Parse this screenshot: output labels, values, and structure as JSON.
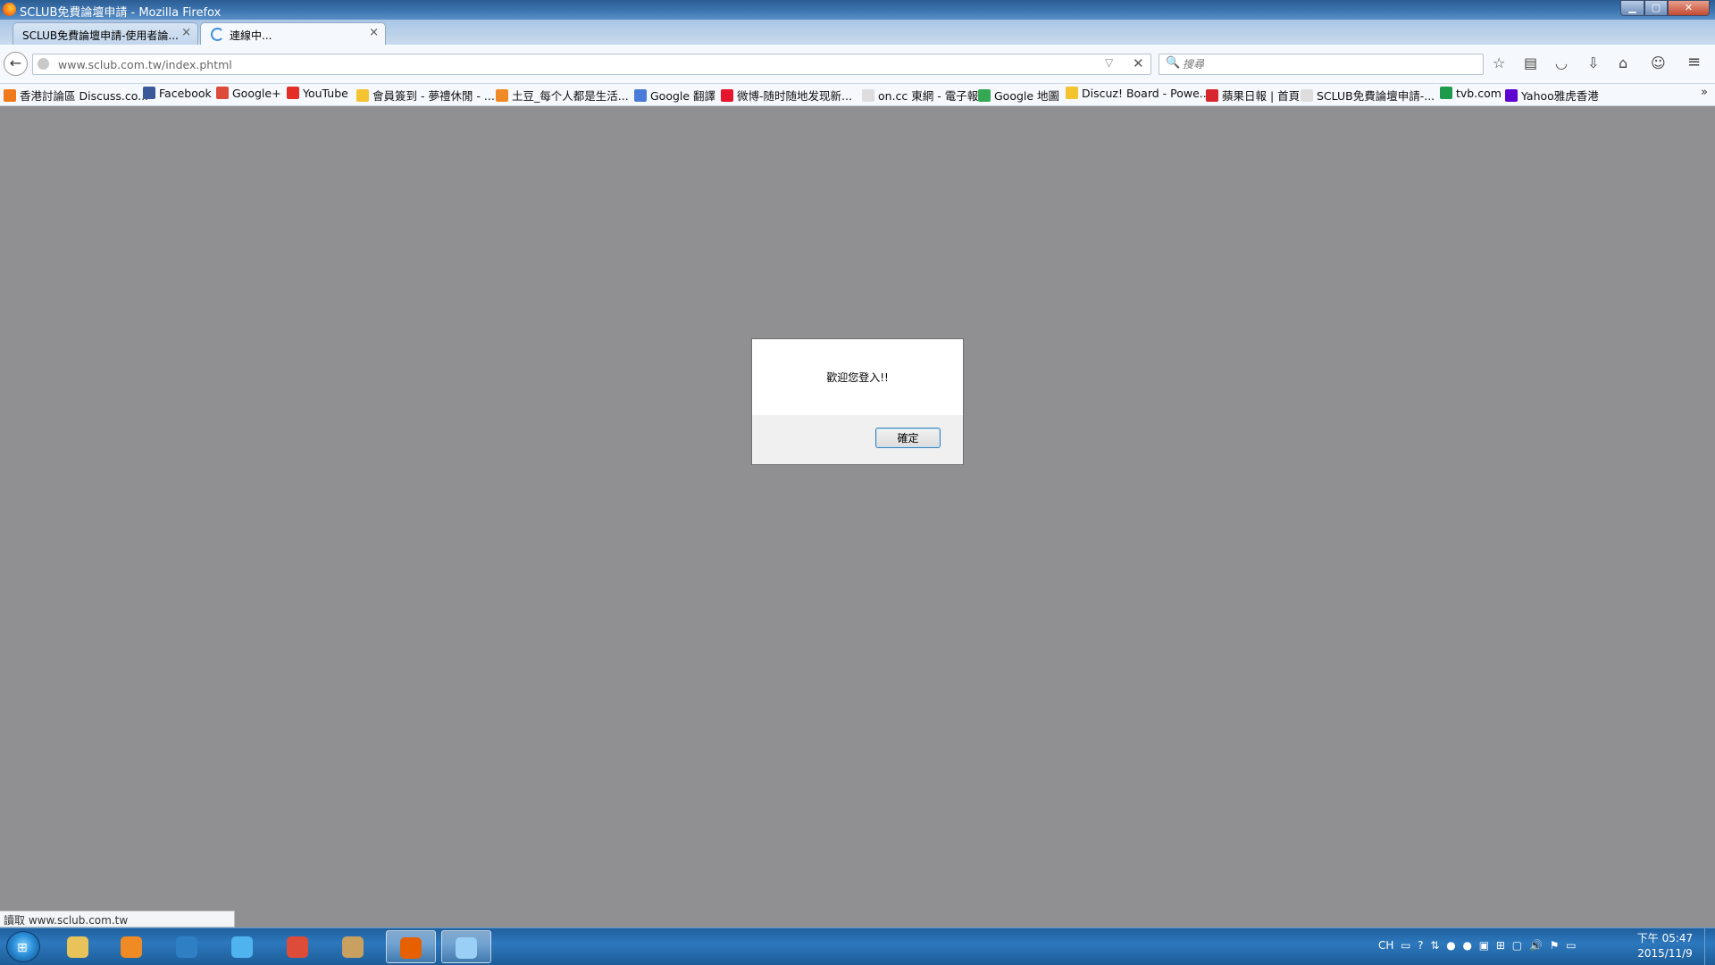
{
  "window": {
    "title": "SCLUB免費論壇申請 - Mozilla Firefox",
    "min_glyph": "▁",
    "max_glyph": "▢",
    "close_glyph": "✕"
  },
  "tabs": [
    {
      "label": "SCLUB免費論壇申請-使用者論...",
      "close": "×",
      "active": false
    },
    {
      "label": "連線中...",
      "close": "×",
      "active": true,
      "loading": true
    }
  ],
  "new_tab_glyph": "+",
  "navbar": {
    "back_glyph": "←",
    "url": "www.sclub.com.tw/index.phtml",
    "dropmarker_glyph": "▽",
    "stop_glyph": "✕",
    "search_placeholder": "搜尋",
    "search_glyph": "🔍",
    "icons": {
      "bookmark_star": "☆",
      "library": "▤",
      "pocket": "◡",
      "downloads": "⇩",
      "home": "⌂",
      "chat": "☺",
      "menu": "≡"
    }
  },
  "bookmarks": [
    {
      "label": "香港討論區 Discuss.co...",
      "color": "#f07a1a"
    },
    {
      "label": "Facebook",
      "color": "#3b5998"
    },
    {
      "label": "Google+",
      "color": "#dd4b39"
    },
    {
      "label": "YouTube",
      "color": "#e52d27"
    },
    {
      "label": "會員簽到 - 夢禮休閒 - ...",
      "color": "#f4c430"
    },
    {
      "label": "土豆_每个人都是生活...",
      "color": "#f08a24"
    },
    {
      "label": "Google 翻譯",
      "color": "#4a7bd8"
    },
    {
      "label": "微博-随时随地发现新...",
      "color": "#e6162d"
    },
    {
      "label": "on.cc 東網 - 電子報",
      "color": "#dddddd"
    },
    {
      "label": "Google 地圖",
      "color": "#34a853"
    },
    {
      "label": "Discuz! Board - Powe...",
      "color": "#f4c430"
    },
    {
      "label": "蘋果日報 | 首頁",
      "color": "#d8262e"
    },
    {
      "label": "SCLUB免費論壇申請-...",
      "color": "#dddddd"
    },
    {
      "label": "tvb.com",
      "color": "#1d9a4a"
    },
    {
      "label": "Yahoo雅虎香港",
      "color": "#5f01d1"
    }
  ],
  "bookmarks_more_glyph": "»",
  "dialog": {
    "message": "歡迎您登入!!",
    "ok_label": "確定"
  },
  "status": "讀取 www.sclub.com.tw",
  "taskbar": {
    "start_glyph": "⊞",
    "apps": [
      {
        "name": "explorer",
        "color": "#e8c35a",
        "active": false
      },
      {
        "name": "media-player",
        "color": "#f08a24",
        "active": false
      },
      {
        "name": "kmplayer",
        "color": "#2f7fc4",
        "active": false
      },
      {
        "name": "internet-explorer",
        "color": "#4fb3f0",
        "active": false
      },
      {
        "name": "chrome",
        "color": "#dd4b39",
        "active": false
      },
      {
        "name": "app-tools",
        "color": "#c8a060",
        "active": false
      },
      {
        "name": "firefox",
        "color": "#e66000",
        "active": true
      },
      {
        "name": "paint",
        "color": "#9ad0f5",
        "active": true
      }
    ],
    "tray": {
      "lang": "CH",
      "icons": "▭ ? ⇅ ● ● ▣ ⊞ ▢ 🔊 ⚑ ▭"
    },
    "time": "下午 05:47",
    "date": "2015/11/9"
  }
}
